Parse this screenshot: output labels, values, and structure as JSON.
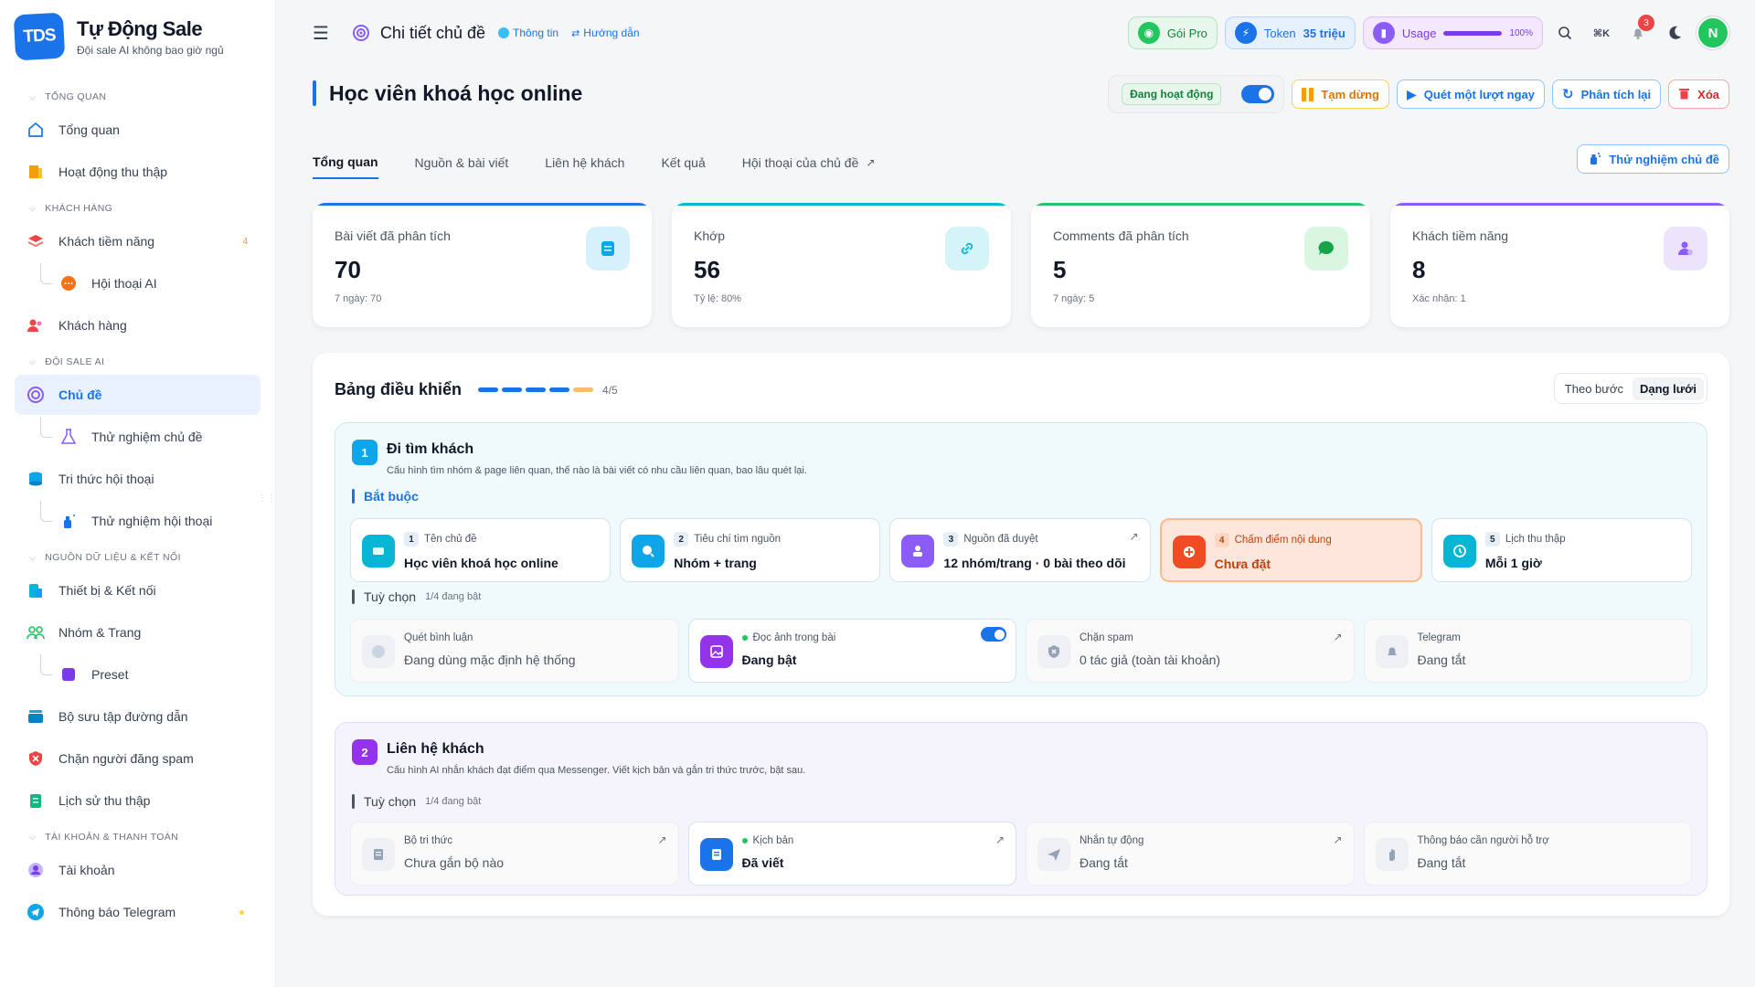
{
  "brand": {
    "logo": "TDS",
    "title": "Tự Động Sale",
    "subtitle": "Đội sale AI không bao giờ ngủ"
  },
  "sidebar": {
    "sections": [
      {
        "title": "TỔNG QUAN",
        "items": [
          {
            "label": "Tổng quan",
            "icon": "home-icon"
          },
          {
            "label": "Hoạt động thu thập",
            "icon": "activity-icon"
          }
        ]
      },
      {
        "title": "KHÁCH HÀNG",
        "items": [
          {
            "label": "Khách tiềm năng",
            "icon": "layers-icon",
            "count": "4"
          },
          {
            "label": "Hội thoại AI",
            "icon": "chat-icon",
            "sub": true
          },
          {
            "label": "Khách hàng",
            "icon": "users-icon"
          }
        ]
      },
      {
        "title": "ĐỘI SALE AI",
        "items": [
          {
            "label": "Chủ đề",
            "icon": "target-icon",
            "active": true
          },
          {
            "label": "Thử nghiệm chủ đề",
            "icon": "flask-icon",
            "sub": true
          },
          {
            "label": "Tri thức hội thoại",
            "icon": "database-icon"
          },
          {
            "label": "Thử nghiệm hội thoại",
            "icon": "spray-icon",
            "sub": true
          }
        ]
      },
      {
        "title": "NGUỒN DỮ LIỆU & KẾT NỐI",
        "items": [
          {
            "label": "Thiết bị & Kết nối",
            "icon": "device-icon"
          },
          {
            "label": "Nhóm & Trang",
            "icon": "group-icon"
          },
          {
            "label": "Preset",
            "icon": "preset-icon",
            "sub": true
          },
          {
            "label": "Bộ sưu tập đường dẫn",
            "icon": "collection-icon"
          },
          {
            "label": "Chặn người đăng spam",
            "icon": "block-icon"
          },
          {
            "label": "Lịch sử thu thập",
            "icon": "history-icon"
          }
        ]
      },
      {
        "title": "TÀI KHOẢN & THANH TOÁN",
        "items": [
          {
            "label": "Tài khoản",
            "icon": "account-icon"
          },
          {
            "label": "Thông báo Telegram",
            "icon": "telegram-icon"
          }
        ]
      }
    ]
  },
  "topbar": {
    "title": "Chi tiết chủ đề",
    "info_link": "Thông tin",
    "guide_link": "Hướng dẫn",
    "plan": "Gói Pro",
    "token_label": "Token",
    "token_value": "35 triệu",
    "usage_label": "Usage",
    "usage_percent": "100%",
    "usage_fraction": 1.0,
    "shortcut": "⌘K",
    "notifications": "3",
    "avatar": "N"
  },
  "page": {
    "title": "Học viên khoá học online",
    "status": "Đang hoạt động",
    "pause": "Tạm dừng",
    "scan_now": "Quét một lượt ngay",
    "reanalyze": "Phân tích lại",
    "delete": "Xóa",
    "test_topic": "Thử nghiệm chủ đề"
  },
  "tabs": [
    {
      "label": "Tổng quan",
      "active": true
    },
    {
      "label": "Nguồn & bài viết"
    },
    {
      "label": "Liên hệ khách"
    },
    {
      "label": "Kết quả"
    },
    {
      "label": "Hội thoại của chủ đề"
    }
  ],
  "stats": [
    {
      "label": "Bài viết đã phân tích",
      "value": "70",
      "sub": "7 ngày: 70",
      "icon": "document-icon",
      "color": "#0ea5e9",
      "bg": "#d6f1fb"
    },
    {
      "label": "Khớp",
      "value": "56",
      "sub": "Tỷ lệ: 80%",
      "icon": "link-icon",
      "color": "#06b6d4",
      "bg": "#d5f4f8"
    },
    {
      "label": "Comments đã phân tích",
      "value": "5",
      "sub": "7 ngày: 5",
      "icon": "comment-icon",
      "color": "#22c55e",
      "bg": "#d9f6e1"
    },
    {
      "label": "Khách tiềm năng",
      "value": "8",
      "sub": "Xác nhận: 1",
      "icon": "person-icon",
      "color": "#8b5cf6",
      "bg": "#ece4fc"
    }
  ],
  "dashboard": {
    "title": "Bảng điều khiển",
    "progress_text": "4/5",
    "progress_done": 4,
    "progress_total": 5,
    "view_step": "Theo bước",
    "view_grid": "Dạng lưới"
  },
  "step1": {
    "num": "1",
    "title": "Đi tìm khách",
    "desc": "Cấu hình tìm nhóm & page liên quan, thế nào là bài viết có nhu cầu liên quan, bao lâu quét lại.",
    "required_label": "Bắt buộc",
    "required": [
      {
        "num": "1",
        "label": "Tên chủ đề",
        "value": "Học viên khoá học online",
        "icon": "tag-icon",
        "color": "#06b6d4"
      },
      {
        "num": "2",
        "label": "Tiêu chí tìm nguồn",
        "value": "Nhóm + trang",
        "icon": "search-icon",
        "color": "#0ea5e9"
      },
      {
        "num": "3",
        "label": "Nguồn đã duyệt",
        "value": "12 nhóm/trang · 0 bài theo dõi",
        "icon": "people-icon",
        "color": "#8b5cf6",
        "ext": true
      },
      {
        "num": "4",
        "label": "Chấm điểm nội dung",
        "value": "Chưa đặt",
        "icon": "scoring-icon",
        "color": "#f04b23",
        "highlight": true
      },
      {
        "num": "5",
        "label": "Lịch thu thập",
        "value": "Mỗi 1 giờ",
        "icon": "clock-icon",
        "color": "#06b6d4"
      }
    ],
    "optional_label": "Tuỳ chọn",
    "optional_note": "1/4 đang bật",
    "optional": [
      {
        "label": "Quét bình luận",
        "value": "Đang dùng mặc định hệ thống",
        "icon": "comment-scan-icon",
        "off": true
      },
      {
        "label": "Đọc ảnh trong bài",
        "value": "Đang bật",
        "icon": "image-icon",
        "color": "#9333ea",
        "on": true
      },
      {
        "label": "Chặn spam",
        "value": "0 tác giả (toàn tài khoản)",
        "icon": "shield-icon",
        "off": true,
        "ext": true
      },
      {
        "label": "Telegram",
        "value": "Đang tắt",
        "icon": "bell-icon",
        "off": true
      }
    ]
  },
  "step2": {
    "num": "2",
    "title": "Liên hệ khách",
    "desc": "Cấu hình AI nhắn khách đạt điểm qua Messenger. Viết kịch bản và gắn tri thức trước, bật sau.",
    "optional_label": "Tuỳ chọn",
    "optional_note": "1/4 đang bật",
    "optional": [
      {
        "label": "Bộ tri thức",
        "value": "Chưa gắn bộ nào",
        "icon": "knowledge-icon",
        "off": true,
        "ext": true
      },
      {
        "label": "Kịch bản",
        "value": "Đã viết",
        "icon": "script-icon",
        "color": "#1a73e8",
        "on": true,
        "ext": true
      },
      {
        "label": "Nhắn tự động",
        "value": "Đang tắt",
        "icon": "send-icon",
        "off": true,
        "ext": true
      },
      {
        "label": "Thông báo cần người hỗ trợ",
        "value": "Đang tắt",
        "icon": "hand-icon",
        "off": true
      }
    ]
  },
  "colors": {
    "accent": "#1a73e8",
    "success": "#22c55e",
    "warning": "#f59e0b",
    "danger": "#ef4444",
    "purple": "#8b5cf6"
  }
}
